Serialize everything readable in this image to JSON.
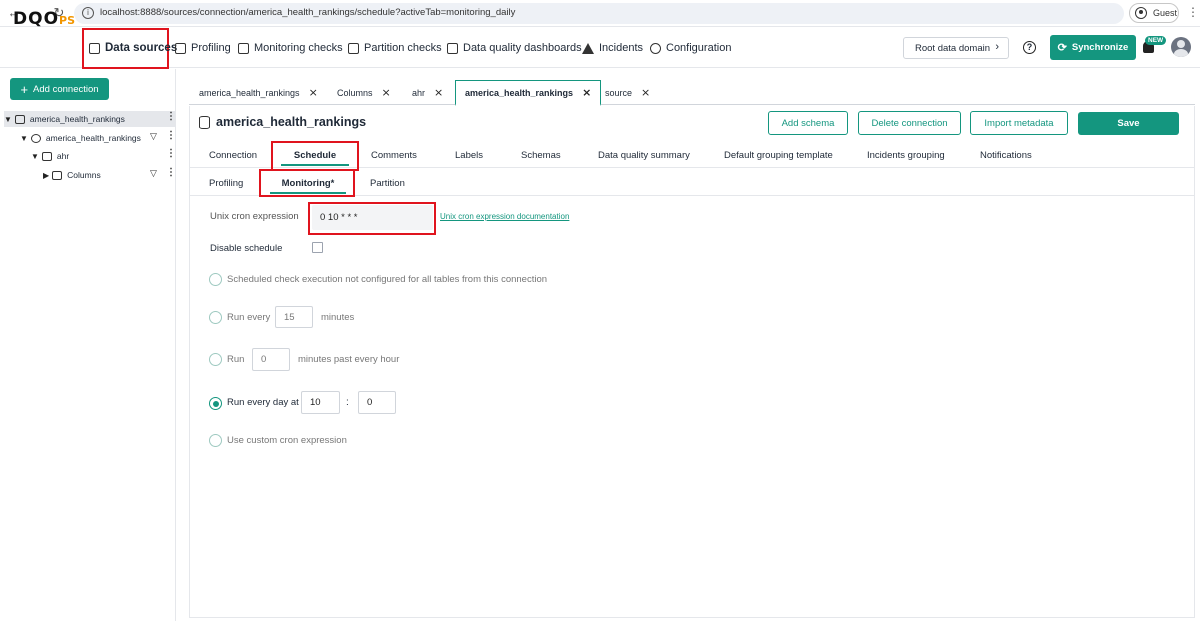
{
  "browser": {
    "url": "localhost:8888/sources/connection/america_health_rankings/schedule?activeTab=monitoring_daily",
    "profile_label": "Guest"
  },
  "header": {
    "logo_main": "DQO",
    "logo_suffix": "PS",
    "nav": [
      "Data sources",
      "Profiling",
      "Monitoring checks",
      "Partition checks",
      "Data quality dashboards",
      "Incidents",
      "Configuration"
    ],
    "root_domain": "Root data domain",
    "synchronize": "Synchronize",
    "new_badge": "NEW"
  },
  "sidebar": {
    "add_connection": "Add connection",
    "tree": [
      "america_health_rankings",
      "america_health_rankings",
      "ahr",
      "Columns"
    ]
  },
  "open_tabs": [
    "america_health_rankings",
    "Columns",
    "ahr",
    "america_health_rankings",
    "source"
  ],
  "connection": {
    "title": "america_health_rankings",
    "buttons": {
      "add_schema": "Add schema",
      "delete_connection": "Delete connection",
      "import_metadata": "Import metadata",
      "save": "Save"
    }
  },
  "main_tabs": [
    "Connection",
    "Schedule",
    "Comments",
    "Labels",
    "Schemas",
    "Data quality summary",
    "Default grouping template",
    "Incidents grouping",
    "Notifications"
  ],
  "sub_tabs": [
    "Profiling",
    "Monitoring*",
    "Partition"
  ],
  "schedule": {
    "cron_label": "Unix cron expression",
    "cron_value": "0 10 * * *",
    "cron_doc_link": "Unix cron expression documentation",
    "disable_label": "Disable schedule",
    "opt_not_configured": "Scheduled check execution not configured for all tables from this connection",
    "opt_every_prefix": "Run every",
    "opt_every_value": "15",
    "opt_every_suffix": "minutes",
    "opt_hour_prefix": "Run",
    "opt_hour_value": "0",
    "opt_hour_suffix": "minutes past every hour",
    "opt_daily_prefix": "Run every day at",
    "opt_daily_hour": "10",
    "opt_daily_sep": ":",
    "opt_daily_minute": "0",
    "opt_custom": "Use custom cron expression",
    "selected_option": "Run every day at"
  },
  "colors": {
    "accent": "#14967f",
    "highlight": "#e0141e"
  }
}
